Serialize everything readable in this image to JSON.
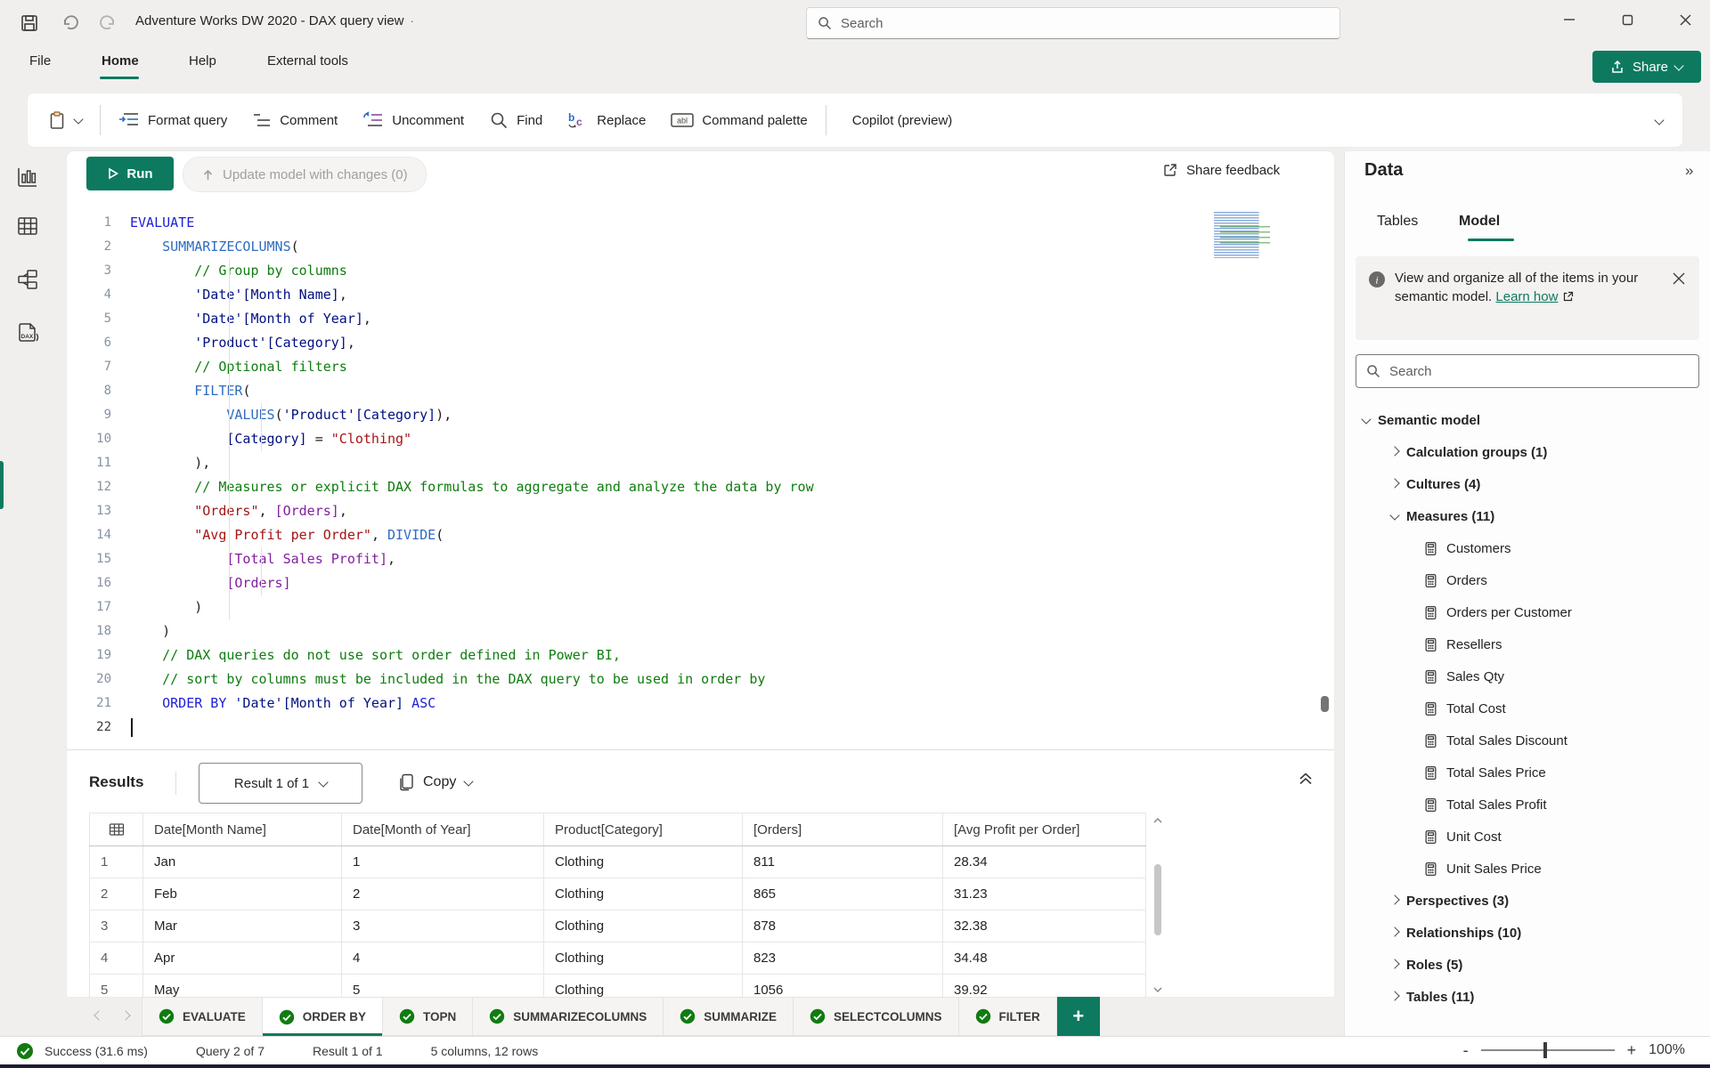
{
  "colors": {
    "accent": "#0d7a5f",
    "success_green": "#107c10",
    "code": {
      "kw": "#1f1fd4",
      "fn": "#2f6cc1",
      "cm": "#0f7d0f",
      "en": "#001080",
      "st": "#a31515",
      "ms": "#811f9e",
      "pl": "#201f1e"
    }
  },
  "title_bar": {
    "title": "Adventure Works DW 2020 - DAX query view",
    "title_suffix": "·",
    "search_placeholder": "Search"
  },
  "ribbon": {
    "tabs": [
      "File",
      "Home",
      "Help",
      "External tools"
    ],
    "active_tab": "Home",
    "share_label": "Share"
  },
  "toolbar": {
    "items": [
      {
        "icon": "format-query-icon",
        "label": "Format query"
      },
      {
        "icon": "comment-icon",
        "label": "Comment"
      },
      {
        "icon": "uncomment-icon",
        "label": "Uncomment"
      },
      {
        "icon": "find-icon",
        "label": "Find"
      },
      {
        "icon": "replace-icon",
        "label": "Replace"
      },
      {
        "icon": "command-palette-icon",
        "label": "Command palette"
      },
      {
        "divider": true
      },
      {
        "icon": "copilot-icon",
        "label": "Copilot (preview)"
      }
    ]
  },
  "editor": {
    "run_label": "Run",
    "update_label": "Update model with changes (0)",
    "share_feedback_label": "Share feedback",
    "lines": [
      {
        "n": 1,
        "segs": [
          {
            "t": "EVALUATE",
            "c": "kw"
          }
        ]
      },
      {
        "n": 2,
        "segs": [
          {
            "t": "    ",
            "c": "pl"
          },
          {
            "t": "SUMMARIZECOLUMNS",
            "c": "fn"
          },
          {
            "t": "(",
            "c": "pl"
          }
        ]
      },
      {
        "n": 3,
        "segs": [
          {
            "t": "        ",
            "c": "pl"
          },
          {
            "t": "// Group by columns",
            "c": "cm"
          }
        ]
      },
      {
        "n": 4,
        "segs": [
          {
            "t": "        ",
            "c": "pl"
          },
          {
            "t": "'Date'[Month Name]",
            "c": "en"
          },
          {
            "t": ",",
            "c": "pl"
          }
        ]
      },
      {
        "n": 5,
        "segs": [
          {
            "t": "        ",
            "c": "pl"
          },
          {
            "t": "'Date'[Month of Year]",
            "c": "en"
          },
          {
            "t": ",",
            "c": "pl"
          }
        ]
      },
      {
        "n": 6,
        "segs": [
          {
            "t": "        ",
            "c": "pl"
          },
          {
            "t": "'Product'[Category]",
            "c": "en"
          },
          {
            "t": ",",
            "c": "pl"
          }
        ]
      },
      {
        "n": 7,
        "segs": [
          {
            "t": "        ",
            "c": "pl"
          },
          {
            "t": "// Optional filters",
            "c": "cm"
          }
        ]
      },
      {
        "n": 8,
        "segs": [
          {
            "t": "        ",
            "c": "pl"
          },
          {
            "t": "FILTER",
            "c": "fn"
          },
          {
            "t": "(",
            "c": "pl"
          }
        ]
      },
      {
        "n": 9,
        "segs": [
          {
            "t": "            ",
            "c": "pl"
          },
          {
            "t": "VALUES",
            "c": "fn"
          },
          {
            "t": "(",
            "c": "pl"
          },
          {
            "t": "'Product'[Category]",
            "c": "en"
          },
          {
            "t": "),",
            "c": "pl"
          }
        ]
      },
      {
        "n": 10,
        "segs": [
          {
            "t": "            ",
            "c": "pl"
          },
          {
            "t": "[Category]",
            "c": "en"
          },
          {
            "t": " = ",
            "c": "pl"
          },
          {
            "t": "\"Clothing\"",
            "c": "st"
          }
        ]
      },
      {
        "n": 11,
        "segs": [
          {
            "t": "        ",
            "c": "pl"
          },
          {
            "t": "),",
            "c": "pl"
          }
        ]
      },
      {
        "n": 12,
        "segs": [
          {
            "t": "        ",
            "c": "pl"
          },
          {
            "t": "// Measures or explicit DAX formulas to aggregate and analyze the data by row",
            "c": "cm"
          }
        ]
      },
      {
        "n": 13,
        "segs": [
          {
            "t": "        ",
            "c": "pl"
          },
          {
            "t": "\"Orders\"",
            "c": "st"
          },
          {
            "t": ", ",
            "c": "pl"
          },
          {
            "t": "[Orders]",
            "c": "ms"
          },
          {
            "t": ",",
            "c": "pl"
          }
        ]
      },
      {
        "n": 14,
        "segs": [
          {
            "t": "        ",
            "c": "pl"
          },
          {
            "t": "\"Avg Profit per Order\"",
            "c": "st"
          },
          {
            "t": ", ",
            "c": "pl"
          },
          {
            "t": "DIVIDE",
            "c": "fn"
          },
          {
            "t": "(",
            "c": "pl"
          }
        ]
      },
      {
        "n": 15,
        "segs": [
          {
            "t": "            ",
            "c": "pl"
          },
          {
            "t": "[Total Sales Profit]",
            "c": "ms"
          },
          {
            "t": ",",
            "c": "pl"
          }
        ]
      },
      {
        "n": 16,
        "segs": [
          {
            "t": "            ",
            "c": "pl"
          },
          {
            "t": "[Orders]",
            "c": "ms"
          }
        ]
      },
      {
        "n": 17,
        "segs": [
          {
            "t": "        ",
            "c": "pl"
          },
          {
            "t": ")",
            "c": "pl"
          }
        ]
      },
      {
        "n": 18,
        "segs": [
          {
            "t": "    ",
            "c": "pl"
          },
          {
            "t": ")",
            "c": "pl"
          }
        ]
      },
      {
        "n": 19,
        "segs": [
          {
            "t": "    ",
            "c": "pl"
          },
          {
            "t": "// DAX queries do not use sort order defined in Power BI,",
            "c": "cm"
          }
        ]
      },
      {
        "n": 20,
        "segs": [
          {
            "t": "    ",
            "c": "pl"
          },
          {
            "t": "// sort by columns must be included in the DAX query to be used in order by",
            "c": "cm"
          }
        ]
      },
      {
        "n": 21,
        "segs": [
          {
            "t": "    ",
            "c": "pl"
          },
          {
            "t": "ORDER BY",
            "c": "kw"
          },
          {
            "t": " ",
            "c": "pl"
          },
          {
            "t": "'Date'[Month of Year]",
            "c": "en"
          },
          {
            "t": " ",
            "c": "pl"
          },
          {
            "t": "ASC",
            "c": "kw"
          }
        ]
      },
      {
        "n": 22,
        "segs": [],
        "cursor": true,
        "copilot": true
      }
    ]
  },
  "results": {
    "label": "Results",
    "result_selector": "Result 1 of 1",
    "copy_label": "Copy",
    "table": {
      "columns": [
        "Date[Month Name]",
        "Date[Month of Year]",
        "Product[Category]",
        "[Orders]",
        "[Avg Profit per Order]"
      ],
      "rows": [
        {
          "num": "1",
          "cells": [
            "Jan",
            "1",
            "Clothing",
            "811",
            "28.34"
          ]
        },
        {
          "num": "2",
          "cells": [
            "Feb",
            "2",
            "Clothing",
            "865",
            "31.23"
          ]
        },
        {
          "num": "3",
          "cells": [
            "Mar",
            "3",
            "Clothing",
            "878",
            "32.38"
          ]
        },
        {
          "num": "4",
          "cells": [
            "Apr",
            "4",
            "Clothing",
            "823",
            "34.48"
          ]
        },
        {
          "num": "5",
          "cells": [
            "May",
            "5",
            "Clothing",
            "1056",
            "39.92"
          ]
        }
      ]
    }
  },
  "query_tabs": {
    "tabs": [
      "EVALUATE",
      "ORDER BY",
      "TOPN",
      "SUMMARIZECOLUMNS",
      "SUMMARIZE",
      "SELECTCOLUMNS",
      "FILTER"
    ],
    "active": "ORDER BY",
    "add_label": "+"
  },
  "status_bar": {
    "success": "Success (31.6 ms)",
    "query": "Query 2 of 7",
    "result": "Result 1 of 1",
    "dims": "5 columns, 12 rows",
    "zoom_minus": "-",
    "zoom_plus": "+",
    "zoom": "100%"
  },
  "data_pane": {
    "title": "Data",
    "tabs": [
      "Tables",
      "Model"
    ],
    "active_tab": "Model",
    "banner_text": "View and organize all of the items in your semantic model. ",
    "banner_link": "Learn how",
    "search_placeholder": "Search",
    "tree": [
      {
        "label": "Semantic model",
        "level": 0,
        "chev": "down",
        "bold": true
      },
      {
        "label": "Calculation groups (1)",
        "level": 1,
        "chev": "right",
        "bold": true
      },
      {
        "label": "Cultures (4)",
        "level": 1,
        "chev": "right",
        "bold": true
      },
      {
        "label": "Measures (11)",
        "level": 1,
        "chev": "down",
        "bold": true
      },
      {
        "label": "Customers",
        "level": 2,
        "icon": "calculator-icon"
      },
      {
        "label": "Orders",
        "level": 2,
        "icon": "calculator-icon"
      },
      {
        "label": "Orders per Customer",
        "level": 2,
        "icon": "calculator-icon"
      },
      {
        "label": "Resellers",
        "level": 2,
        "icon": "calculator-icon"
      },
      {
        "label": "Sales Qty",
        "level": 2,
        "icon": "calculator-icon"
      },
      {
        "label": "Total Cost",
        "level": 2,
        "icon": "calculator-icon"
      },
      {
        "label": "Total Sales Discount",
        "level": 2,
        "icon": "calculator-icon"
      },
      {
        "label": "Total Sales Price",
        "level": 2,
        "icon": "calculator-icon"
      },
      {
        "label": "Total Sales Profit",
        "level": 2,
        "icon": "calculator-icon"
      },
      {
        "label": "Unit Cost",
        "level": 2,
        "icon": "calculator-icon"
      },
      {
        "label": "Unit Sales Price",
        "level": 2,
        "icon": "calculator-icon"
      },
      {
        "label": "Perspectives (3)",
        "level": 1,
        "chev": "right",
        "bold": true
      },
      {
        "label": "Relationships (10)",
        "level": 1,
        "chev": "right",
        "bold": true
      },
      {
        "label": "Roles (5)",
        "level": 1,
        "chev": "right",
        "bold": true
      },
      {
        "label": "Tables (11)",
        "level": 1,
        "chev": "right",
        "bold": true
      }
    ]
  }
}
